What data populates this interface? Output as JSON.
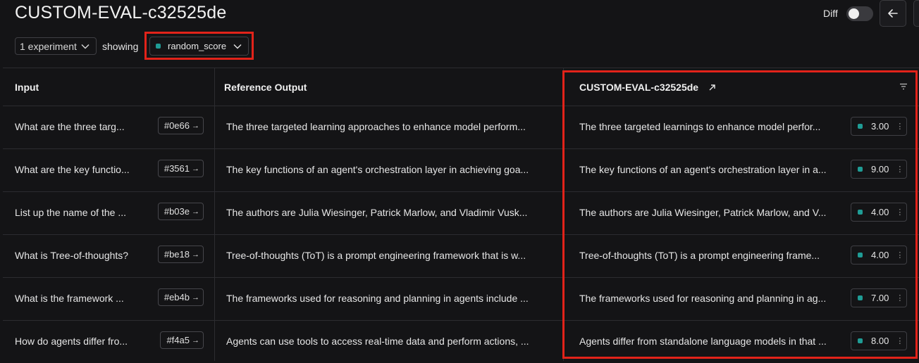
{
  "header": {
    "title": "CUSTOM-EVAL-c32525de",
    "diff_label": "Diff",
    "diff_enabled": false
  },
  "toolbar": {
    "experiment_select": "1 experiment",
    "showing_label": "showing",
    "score_select": "random_score"
  },
  "colors": {
    "accent_teal": "#1f9c95",
    "highlight_red": "#e2231a"
  },
  "table": {
    "columns": {
      "input": "Input",
      "reference": "Reference Output",
      "experiment": "CUSTOM-EVAL-c32525de"
    },
    "rows": [
      {
        "input": "What are the three targ...",
        "hash": "#0e66",
        "reference": "The three targeted learning approaches to enhance model perform...",
        "output": "The three targeted learnings to enhance model perfor...",
        "score": "3.00"
      },
      {
        "input": "What are the key functio...",
        "hash": "#3561",
        "reference": "The key functions of an agent's orchestration layer in achieving goa...",
        "output": "The key functions of an agent's orchestration layer in a...",
        "score": "9.00"
      },
      {
        "input": "List up the name of the ...",
        "hash": "#b03e",
        "reference": "The authors are Julia Wiesinger, Patrick Marlow, and Vladimir Vusk...",
        "output": "The authors are Julia Wiesinger, Patrick Marlow, and V...",
        "score": "4.00"
      },
      {
        "input": "What is Tree-of-thoughts?",
        "hash": "#be18",
        "reference": "Tree-of-thoughts (ToT) is a prompt engineering framework that is w...",
        "output": "Tree-of-thoughts (ToT) is a prompt engineering frame...",
        "score": "4.00"
      },
      {
        "input": "What is the framework ...",
        "hash": "#eb4b",
        "reference": "The frameworks used for reasoning and planning in agents include ...",
        "output": "The frameworks used for reasoning and planning in ag...",
        "score": "7.00"
      },
      {
        "input": "How do agents differ fro...",
        "hash": "#f4a5",
        "reference": "Agents can use tools to access real-time data and perform actions, ...",
        "output": "Agents differ from standalone language models in that ...",
        "score": "8.00"
      }
    ]
  }
}
